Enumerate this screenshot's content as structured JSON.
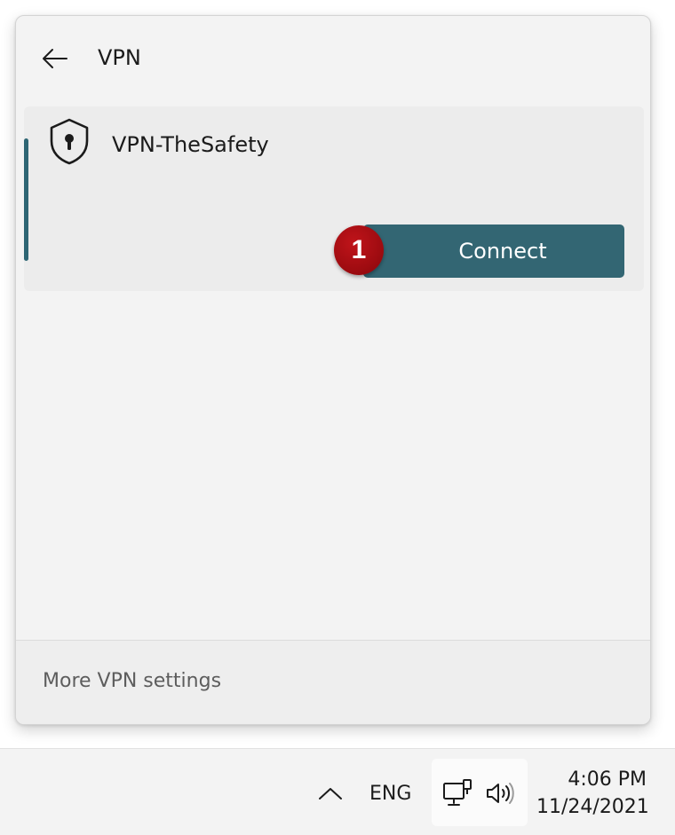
{
  "flyout": {
    "title": "VPN",
    "back_icon": "arrow-left-icon",
    "connection": {
      "name": "VPN-TheSafety",
      "icon": "shield-keyhole-icon",
      "connect_label": "Connect",
      "step_badge": "1",
      "accent_color": "#336673",
      "badge_color": "#a00c11"
    },
    "footer": {
      "link_label": "More VPN settings"
    }
  },
  "taskbar": {
    "chevron_icon": "chevron-up-icon",
    "language": "ENG",
    "network_icon": "wired-network-icon",
    "volume_icon": "speaker-icon",
    "time": "4:06 PM",
    "date": "11/24/2021"
  }
}
